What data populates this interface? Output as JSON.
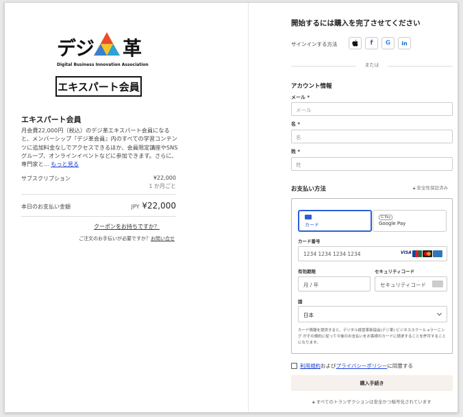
{
  "brand": {
    "logo_left": "デジ",
    "logo_right": "革",
    "logo_sub": "Digital Business Innovation Association",
    "badge": "エキスパート会員"
  },
  "summary": {
    "title": "エキスパート会員",
    "description": "月会費22,000円（税込）のデジ革エキスパート会員になると、メンバーシップ『デジ革会員』内のすべての学習コンテンツに追加料金なしでアクセスできるほか、会員限定講座やSNSグループ、オンラインイベントなどに参加できます。さらに、専門家と...",
    "more": "もっと見る",
    "subscription_label": "サブスクリプション",
    "subscription_price": "¥22,000",
    "subscription_period": "1 か月ごと",
    "total_label": "本日のお支払い金額",
    "total_currency": "JPY",
    "total_price": "¥22,000",
    "coupon": "クーポンをお持ちですか？",
    "help_text": "ご注文のお手伝いが必要ですか？",
    "help_link": "お問い合せ"
  },
  "checkout": {
    "title": "開始するには購入を完了させてください",
    "signin_label": "サインインする方法",
    "or": "または",
    "account_title": "アカウント情報",
    "email_label": "メール *",
    "email_placeholder": "メール",
    "firstname_label": "名 *",
    "firstname_placeholder": "名",
    "lastname_label": "姓 *",
    "lastname_placeholder": "姓",
    "payment_title": "お支払い方法",
    "secure": "安全性保証済み",
    "tab_card": "カード",
    "tab_gpay": "Google Pay",
    "gpay_badge": "G Pay",
    "card_number_label": "カード番号",
    "card_number_placeholder": "1234 1234 1234 1234",
    "expiry_label": "有効期限",
    "expiry_placeholder": "月 / 年",
    "cvc_label": "セキュリティコード",
    "cvc_placeholder": "セキュリティコード",
    "country_label": "国",
    "country_value": "日本",
    "note": "カード情報を提供すると、デジタル経営革新協会(デジ革) ビジネススクール eラーニング がその規約に従って今後のお支払いをお客様のカードに請求することを許可することになります。",
    "terms_link": "利用規約",
    "terms_and": "および",
    "privacy_link": "プライバシーポリシー",
    "terms_agree": "に同意する",
    "buy_button": "購入手続き",
    "footer": "すべてのトランザクションは安全かつ暗号化されています"
  }
}
